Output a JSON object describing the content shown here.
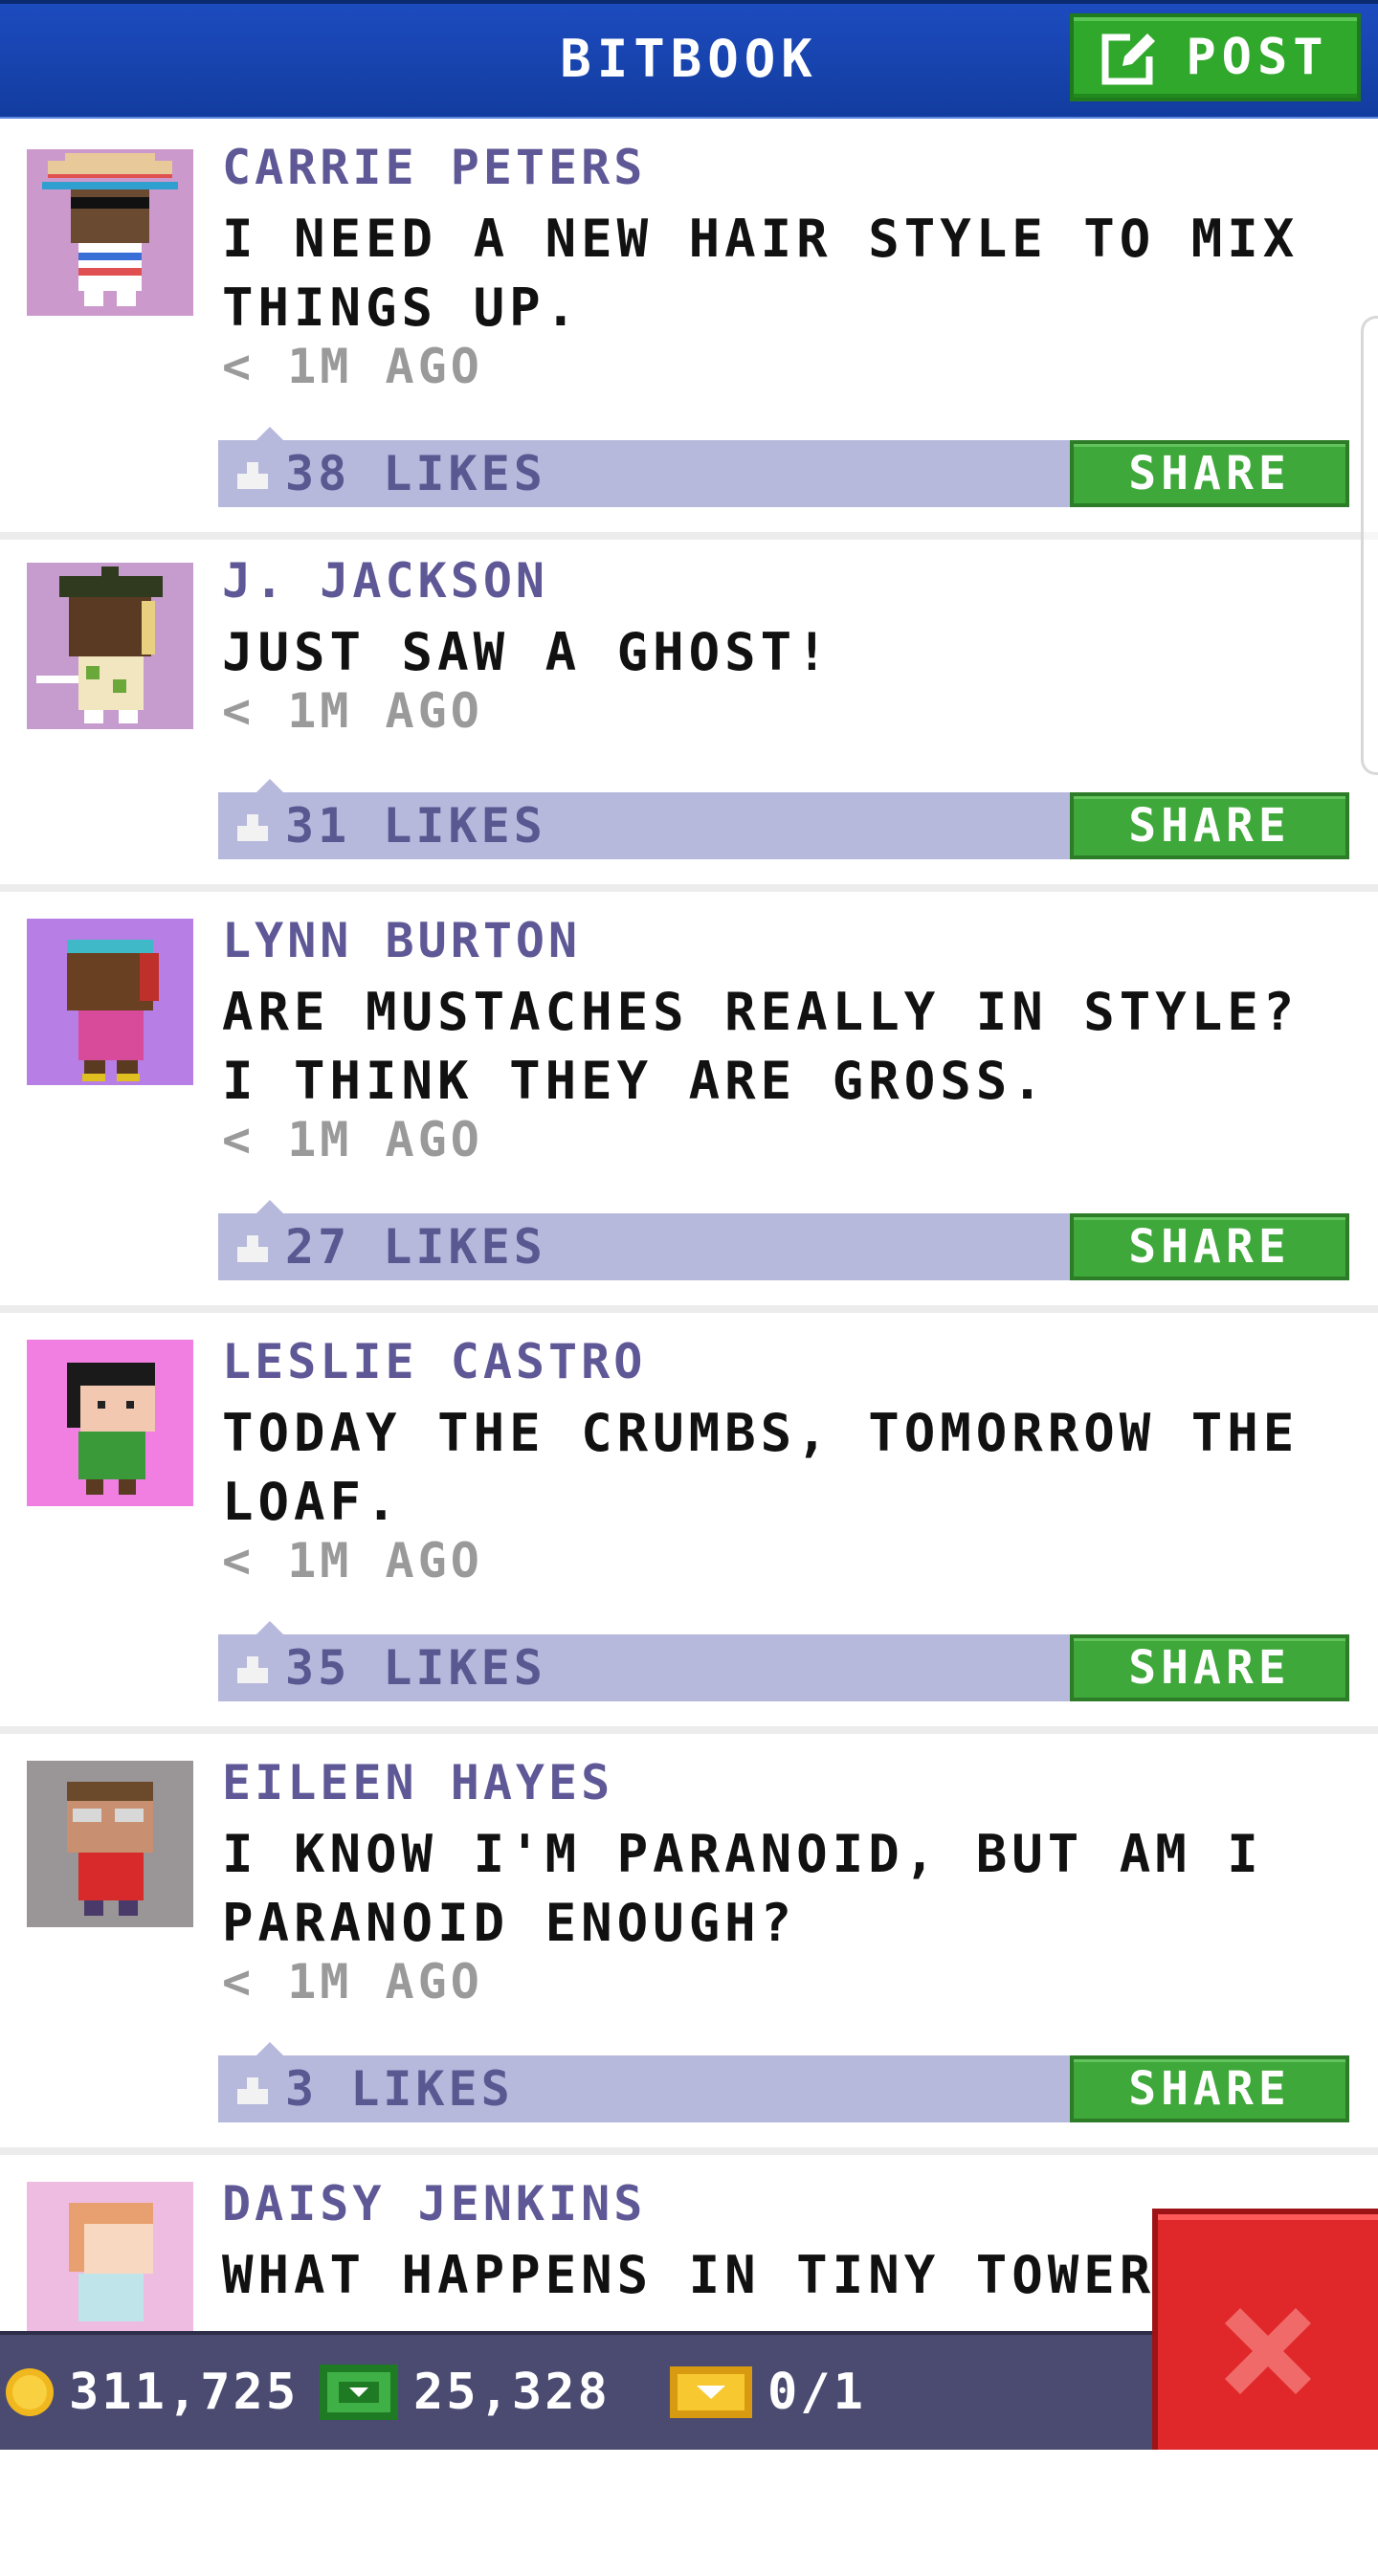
{
  "header": {
    "title": "BITBOOK",
    "post_label": "POST"
  },
  "posts": [
    {
      "name": "CARRIE PETERS",
      "message": "I NEED A NEW HAIR STYLE TO MIX THINGS UP.",
      "time": "< 1M AGO",
      "likes": "38 LIKES",
      "share": "SHARE",
      "avatar_bg": "#cc99cc"
    },
    {
      "name": "J. JACKSON",
      "message": "JUST SAW A GHOST!",
      "time": "< 1M AGO",
      "likes": "31 LIKES",
      "share": "SHARE",
      "avatar_bg": "#c69ccf"
    },
    {
      "name": "LYNN BURTON",
      "message": "ARE MUSTACHES REALLY IN STYLE? I THINK THEY ARE GROSS.",
      "time": "< 1M AGO",
      "likes": "27 LIKES",
      "share": "SHARE",
      "avatar_bg": "#b77fe6"
    },
    {
      "name": "LESLIE CASTRO",
      "message": "TODAY THE CRUMBS, TOMORROW THE LOAF.",
      "time": "< 1M AGO",
      "likes": "35 LIKES",
      "share": "SHARE",
      "avatar_bg": "#f07fe1"
    },
    {
      "name": "EILEEN HAYES",
      "message": "I KNOW I'M PARANOID, BUT AM I PARANOID ENOUGH?",
      "time": "< 1M AGO",
      "likes": "3 LIKES",
      "share": "SHARE",
      "avatar_bg": "#9a9597"
    },
    {
      "name": "DAISY JENKINS",
      "message": "WHAT HAPPENS IN TINY TOWER..",
      "avatar_bg": "#eebce0"
    }
  ],
  "bottom_bar": {
    "coins": "311,725",
    "bux": "25,328",
    "tickets": "0/1"
  },
  "colors": {
    "header": "#1d4cc0",
    "post_button": "#2fa82b",
    "share_button": "#3fa83a",
    "likes_bar": "#b6b8dc",
    "name_text": "#5f5896",
    "bottom_bar": "#4b4b72",
    "close_button": "#e0282a"
  },
  "icons": [
    "edit-icon",
    "like-icon",
    "coin-icon",
    "bux-icon",
    "ticket-icon",
    "close-icon"
  ]
}
